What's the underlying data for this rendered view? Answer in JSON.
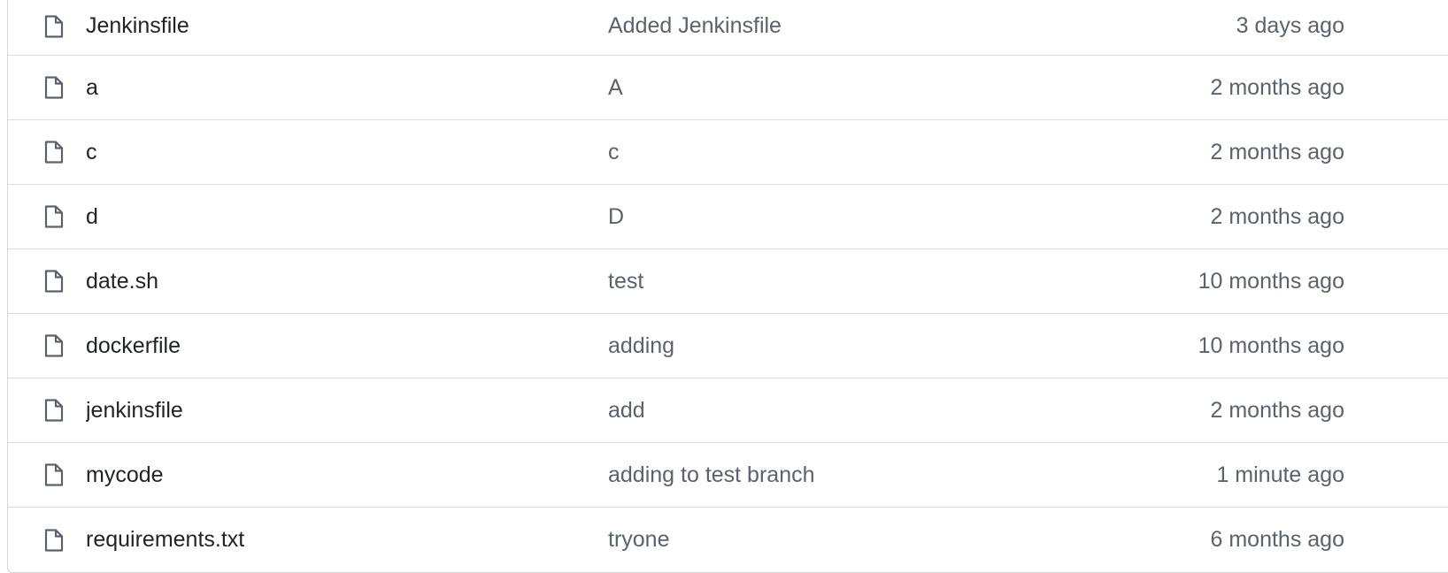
{
  "files": [
    {
      "name": "Jenkinsfile",
      "commit": "Added Jenkinsfile",
      "age": "3 days ago",
      "icon": "file-icon"
    },
    {
      "name": "a",
      "commit": "A",
      "age": "2 months ago",
      "icon": "file-icon"
    },
    {
      "name": "c",
      "commit": "c",
      "age": "2 months ago",
      "icon": "file-icon"
    },
    {
      "name": "d",
      "commit": "D",
      "age": "2 months ago",
      "icon": "file-icon"
    },
    {
      "name": "date.sh",
      "commit": "test",
      "age": "10 months ago",
      "icon": "file-icon"
    },
    {
      "name": "dockerfile",
      "commit": "adding",
      "age": "10 months ago",
      "icon": "file-icon"
    },
    {
      "name": "jenkinsfile",
      "commit": "add",
      "age": "2 months ago",
      "icon": "file-icon"
    },
    {
      "name": "mycode",
      "commit": "adding to test branch",
      "age": "1 minute ago",
      "icon": "file-icon"
    },
    {
      "name": "requirements.txt",
      "commit": "tryone",
      "age": "6 months ago",
      "icon": "file-icon"
    }
  ],
  "colors": {
    "text": "#1f2328",
    "muted": "#59636e",
    "border": "#d0d7de",
    "icon": "#59636e"
  }
}
